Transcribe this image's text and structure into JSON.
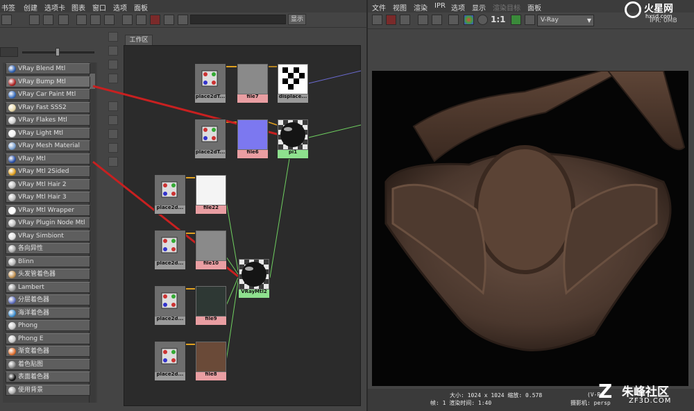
{
  "hypershade": {
    "menu": [
      "书签",
      "创建",
      "选项卡",
      "图表",
      "窗口",
      "选项",
      "面板"
    ],
    "show_button": "显示",
    "work_tab": "工作区",
    "materials": [
      {
        "label": "VRay Blend Mtl",
        "icon": "sphere-blue",
        "color": "#2e5fb0"
      },
      {
        "label": "VRay Bump Mtl",
        "icon": "bump-red",
        "color": "#b02424"
      },
      {
        "label": "VRay Car Paint Mtl",
        "icon": "sphere-blue",
        "color": "#3a6fc0"
      },
      {
        "label": "VRay Fast SSS2",
        "icon": "sss-cream",
        "color": "#e8d8a8"
      },
      {
        "label": "VRay Flakes Mtl",
        "icon": "flakes",
        "color": "#cccccc"
      },
      {
        "label": "VRay Light Mtl",
        "icon": "light-white",
        "color": "#f0f0f0"
      },
      {
        "label": "VRay Mesh Material",
        "icon": "mesh-multi",
        "color": "#7aa0d0"
      },
      {
        "label": "VRay Mtl",
        "icon": "sphere-blue",
        "color": "#2a50a8"
      },
      {
        "label": "VRay Mtl 2Sided",
        "icon": "two-sided",
        "color": "#e0a020"
      },
      {
        "label": "VRay Mtl Hair 2",
        "icon": "sphere-grey",
        "color": "#bbbbbb"
      },
      {
        "label": "VRay Mtl Hair 3",
        "icon": "sphere-grey",
        "color": "#bbbbbb"
      },
      {
        "label": "VRay Mtl Wrapper",
        "icon": "wrapper",
        "color": "#ffffff"
      },
      {
        "label": "VRay Plugin Node Mtl",
        "icon": "sphere-grey",
        "color": "#c0c0c0"
      },
      {
        "label": "VRay Simbiont",
        "icon": "tree",
        "color": "#dddddd"
      },
      {
        "label": "各向异性",
        "icon": "sphere-grey",
        "color": "#aaaaaa"
      },
      {
        "label": "Blinn",
        "icon": "sphere-grey",
        "color": "#b5b5b5"
      },
      {
        "label": "头发管着色器",
        "icon": "hair",
        "color": "#c09050"
      },
      {
        "label": "Lambert",
        "icon": "sphere-grey",
        "color": "#999999"
      },
      {
        "label": "分层着色器",
        "icon": "layered",
        "color": "#6070c0"
      },
      {
        "label": "海洋着色器",
        "icon": "ocean",
        "color": "#4090d0"
      },
      {
        "label": "Phong",
        "icon": "sphere-grey",
        "color": "#c8c8c8"
      },
      {
        "label": "Phong E",
        "icon": "sphere-grey",
        "color": "#c8c8c8"
      },
      {
        "label": "渐变着色器",
        "icon": "ramp",
        "color": "#e07030"
      },
      {
        "label": "着色贴图",
        "icon": "sphere-grey",
        "color": "#888888"
      },
      {
        "label": "表面着色器",
        "icon": "sphere-black",
        "color": "#111111"
      },
      {
        "label": "使用背景",
        "icon": "sphere-grey",
        "color": "#aaaaaa"
      }
    ],
    "nodes": [
      {
        "id": "n-place1",
        "label": "place2dT...",
        "kind": "place"
      },
      {
        "id": "n-file7",
        "label": "file7",
        "kind": "file"
      },
      {
        "id": "n-disp",
        "label": "displace...",
        "kind": "place"
      },
      {
        "id": "n-place2",
        "label": "place2dT...",
        "kind": "place"
      },
      {
        "id": "n-file6",
        "label": "file6",
        "kind": "file"
      },
      {
        "id": "n-pi1",
        "label": "pi1",
        "kind": "mtl"
      },
      {
        "id": "n-place3",
        "label": "place2d...",
        "kind": "place"
      },
      {
        "id": "n-file22",
        "label": "file22",
        "kind": "file"
      },
      {
        "id": "n-place4",
        "label": "place2d...",
        "kind": "place"
      },
      {
        "id": "n-file10",
        "label": "file10",
        "kind": "file"
      },
      {
        "id": "n-vraymtl2",
        "label": "VRayMtl2",
        "kind": "mtl"
      },
      {
        "id": "n-place5",
        "label": "place2d...",
        "kind": "place"
      },
      {
        "id": "n-file9",
        "label": "file9",
        "kind": "file"
      },
      {
        "id": "n-place6",
        "label": "place2d...",
        "kind": "place"
      },
      {
        "id": "n-file8",
        "label": "file8",
        "kind": "file"
      }
    ]
  },
  "render_view": {
    "menu": [
      "文件",
      "视图",
      "渲染",
      "IPR",
      "选项",
      "显示",
      "渲染目标",
      "面板"
    ],
    "ratio": "1:1",
    "renderer": "V-Ray",
    "ipr": "IPR: 0MB",
    "status_line1": "大小: 1024 x 1024  缩放: 0.578",
    "status_line2": "帧: 1        渲染时间: 1:40",
    "status_camera": "(V-Ra",
    "status_camera2": "摄影机: persp"
  },
  "watermark": {
    "top_text": "火星网",
    "top_sub": "hxsd.com",
    "bottom_text": "朱峰社区",
    "bottom_sub": "ZF3D.COM"
  },
  "colors": {
    "accent_red_arrow": "#c82020",
    "file_node": "#e99ea2",
    "mtl_node": "#8ee08e",
    "connection_green": "#6fd060"
  }
}
